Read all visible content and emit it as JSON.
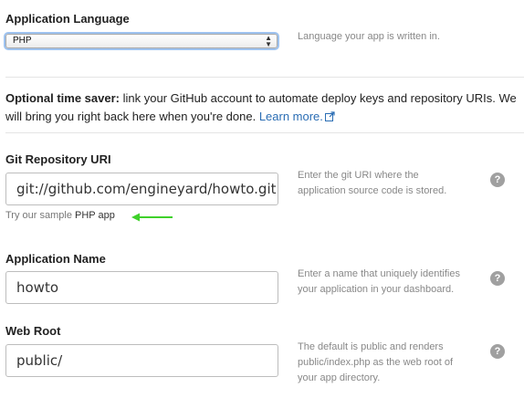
{
  "app_language": {
    "label": "Application Language",
    "selected": "PHP",
    "hint": "Language your app is written in."
  },
  "time_saver": {
    "bold": "Optional time saver:",
    "text": " link your GitHub account to automate deploy keys and repository URIs. We will bring you right back here when you're done. ",
    "link": "Learn more."
  },
  "git_repo": {
    "label": "Git Repository URI",
    "value": "git://github.com/engineyard/howto.git",
    "hint_line1": "Enter the git URI where the",
    "hint_line2": "application source code is stored.",
    "sample_prefix": "Try our sample",
    "sample_link": "PHP app"
  },
  "app_name": {
    "label": "Application Name",
    "value": "howto",
    "hint_line1": "Enter a name that uniquely identifies",
    "hint_line2": "your application in your dashboard."
  },
  "web_root": {
    "label": "Web Root",
    "value": "public/",
    "hint_line1": "The default is public and renders",
    "hint_line2": "public/index.php as the web root of",
    "hint_line3": "your app directory."
  },
  "help_glyph": "?",
  "colors": {
    "link": "#2a6db4",
    "arrow": "#3fd12a",
    "focus_ring": "#9ec3f0"
  }
}
